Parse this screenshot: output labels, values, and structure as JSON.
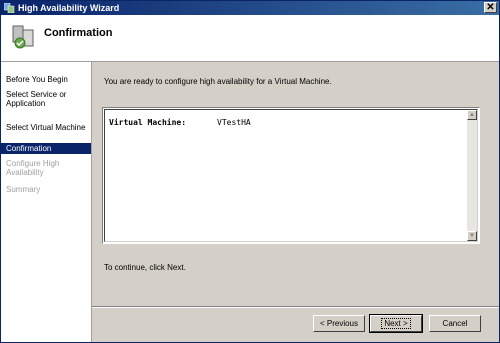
{
  "window": {
    "title": "High Availability Wizard",
    "close_glyph": "✕"
  },
  "header": {
    "title": "Confirmation",
    "icon": "cluster-wizard-icon"
  },
  "nav": {
    "items": [
      {
        "label": "Before You Begin",
        "state": "normal"
      },
      {
        "label": "Select Service or Application",
        "state": "normal"
      },
      {
        "label": "Select Virtual Machine",
        "state": "normal"
      },
      {
        "label": "Confirmation",
        "state": "active"
      },
      {
        "label": "Configure High Availability",
        "state": "disabled"
      },
      {
        "label": "Summary",
        "state": "disabled"
      }
    ]
  },
  "main": {
    "intro": "You are ready to configure high availability for a Virtual Machine.",
    "summary": {
      "label": "Virtual Machine:",
      "value": "VTestHA"
    },
    "footer_text": "To continue, click Next."
  },
  "buttons": {
    "previous": "< Previous",
    "next": "Next >",
    "cancel": "Cancel"
  },
  "colors": {
    "title_bar": "#0a246a",
    "nav_active": "#0a246a"
  }
}
